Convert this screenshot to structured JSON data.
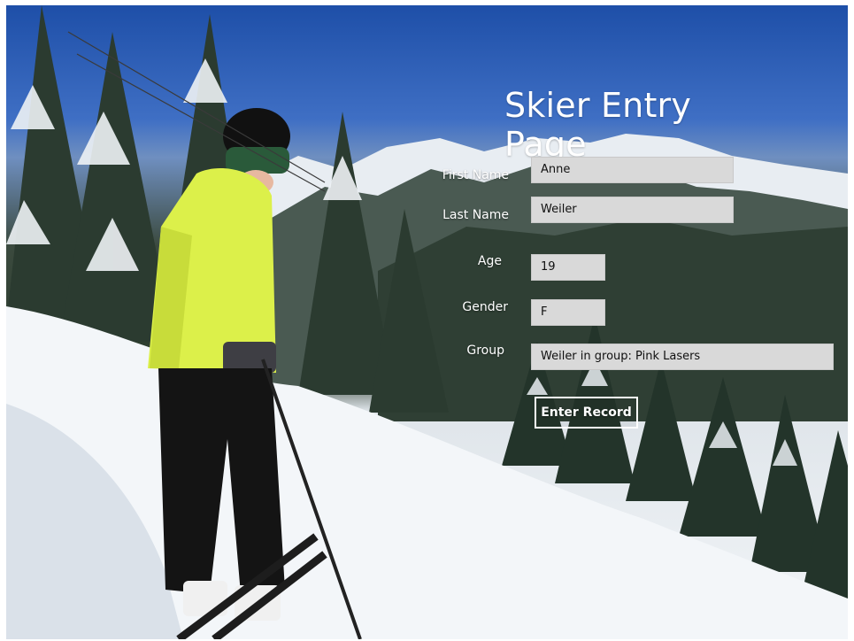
{
  "page": {
    "title": "Skier Entry Page"
  },
  "form": {
    "first_name": {
      "label": "First Name",
      "value": "Anne"
    },
    "last_name": {
      "label": "Last Name",
      "value": "Weiler"
    },
    "age": {
      "label": "Age",
      "value": "19"
    },
    "gender": {
      "label": "Gender",
      "value": "F"
    },
    "group": {
      "label": "Group",
      "value": "Weiler in group: Pink Lasers"
    },
    "submit_label": "Enter Record"
  },
  "colors": {
    "sky": "#1e4fa8",
    "field_bg": "#d9d9d9",
    "text_light": "#ffffff",
    "jacket": "#dcf04a"
  }
}
